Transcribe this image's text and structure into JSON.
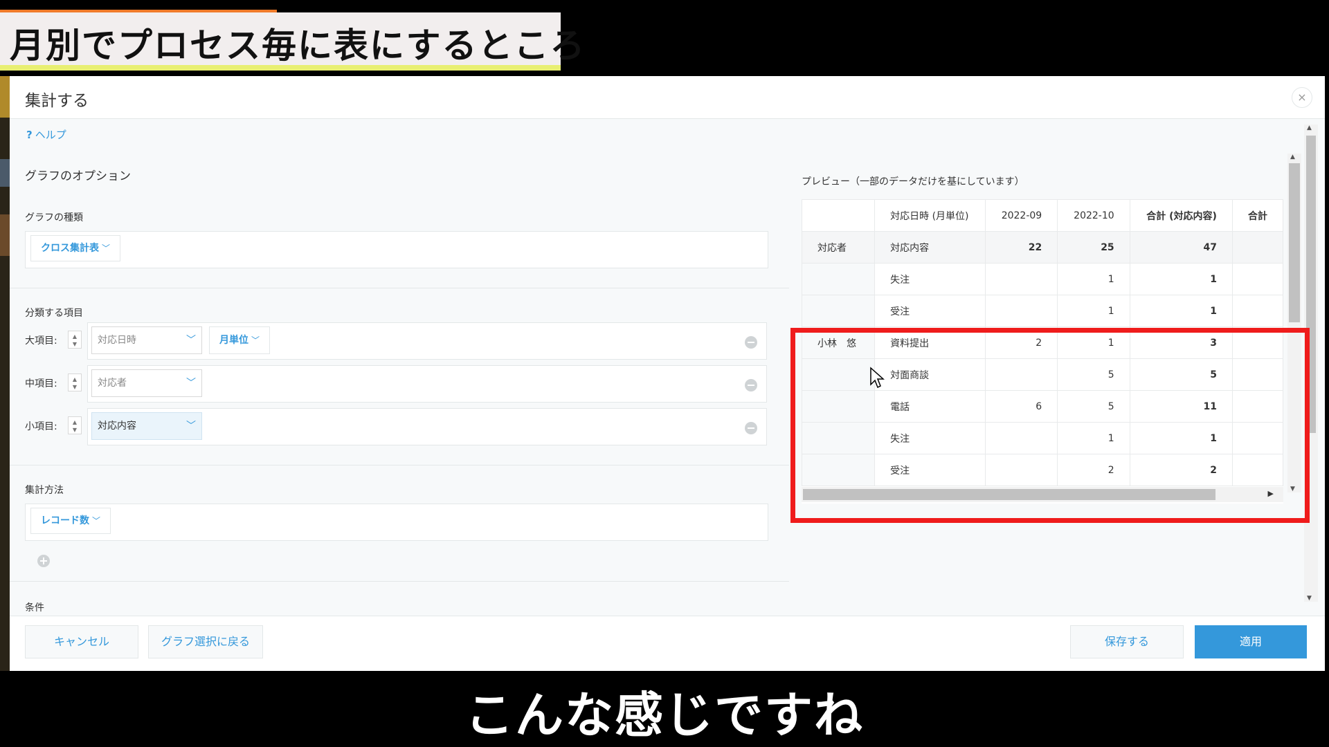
{
  "overlay": {
    "title": "月別でプロセス毎に表にするところ",
    "subtitle": "こんな感じですね"
  },
  "dialog": {
    "title": "集計する",
    "close_label": "×",
    "help_label": "ヘルプ",
    "help_icon": "?",
    "graph_options_title": "グラフのオプション",
    "graph_type": {
      "label": "グラフの種類",
      "value": "クロス集計表"
    },
    "classification": {
      "label": "分類する項目",
      "major": {
        "label": "大項目:",
        "field": "対応日時",
        "unit": "月単位"
      },
      "middle": {
        "label": "中項目:",
        "field": "対応者"
      },
      "minor": {
        "label": "小項目:",
        "field": "対応内容"
      }
    },
    "aggregation": {
      "label": "集計方法",
      "value": "レコード数"
    },
    "condition_label": "条件",
    "preview": {
      "title": "プレビュー（一部のデータだけを基にしています）",
      "header": [
        "",
        "対応日時 (月単位)",
        "2022-09",
        "2022-10",
        "合計 (対応内容)",
        "合計"
      ],
      "rows": [
        [
          "対応者",
          "対応内容",
          "22",
          "25",
          "47",
          ""
        ],
        [
          "",
          "失注",
          "",
          "1",
          "1",
          ""
        ],
        [
          "",
          "受注",
          "",
          "1",
          "1",
          ""
        ],
        [
          "小林　悠",
          "資料提出",
          "2",
          "1",
          "3",
          ""
        ],
        [
          "",
          "対面商談",
          "",
          "5",
          "5",
          ""
        ],
        [
          "",
          "電話",
          "6",
          "5",
          "11",
          ""
        ],
        [
          "",
          "失注",
          "",
          "1",
          "1",
          ""
        ],
        [
          "",
          "受注",
          "",
          "2",
          "2",
          ""
        ]
      ]
    },
    "footer": {
      "cancel": "キャンセル",
      "back": "グラフ選択に戻る",
      "save": "保存する",
      "apply": "適用"
    }
  },
  "colors": {
    "accent": "#3498db",
    "highlight": "#ef1c1c"
  }
}
